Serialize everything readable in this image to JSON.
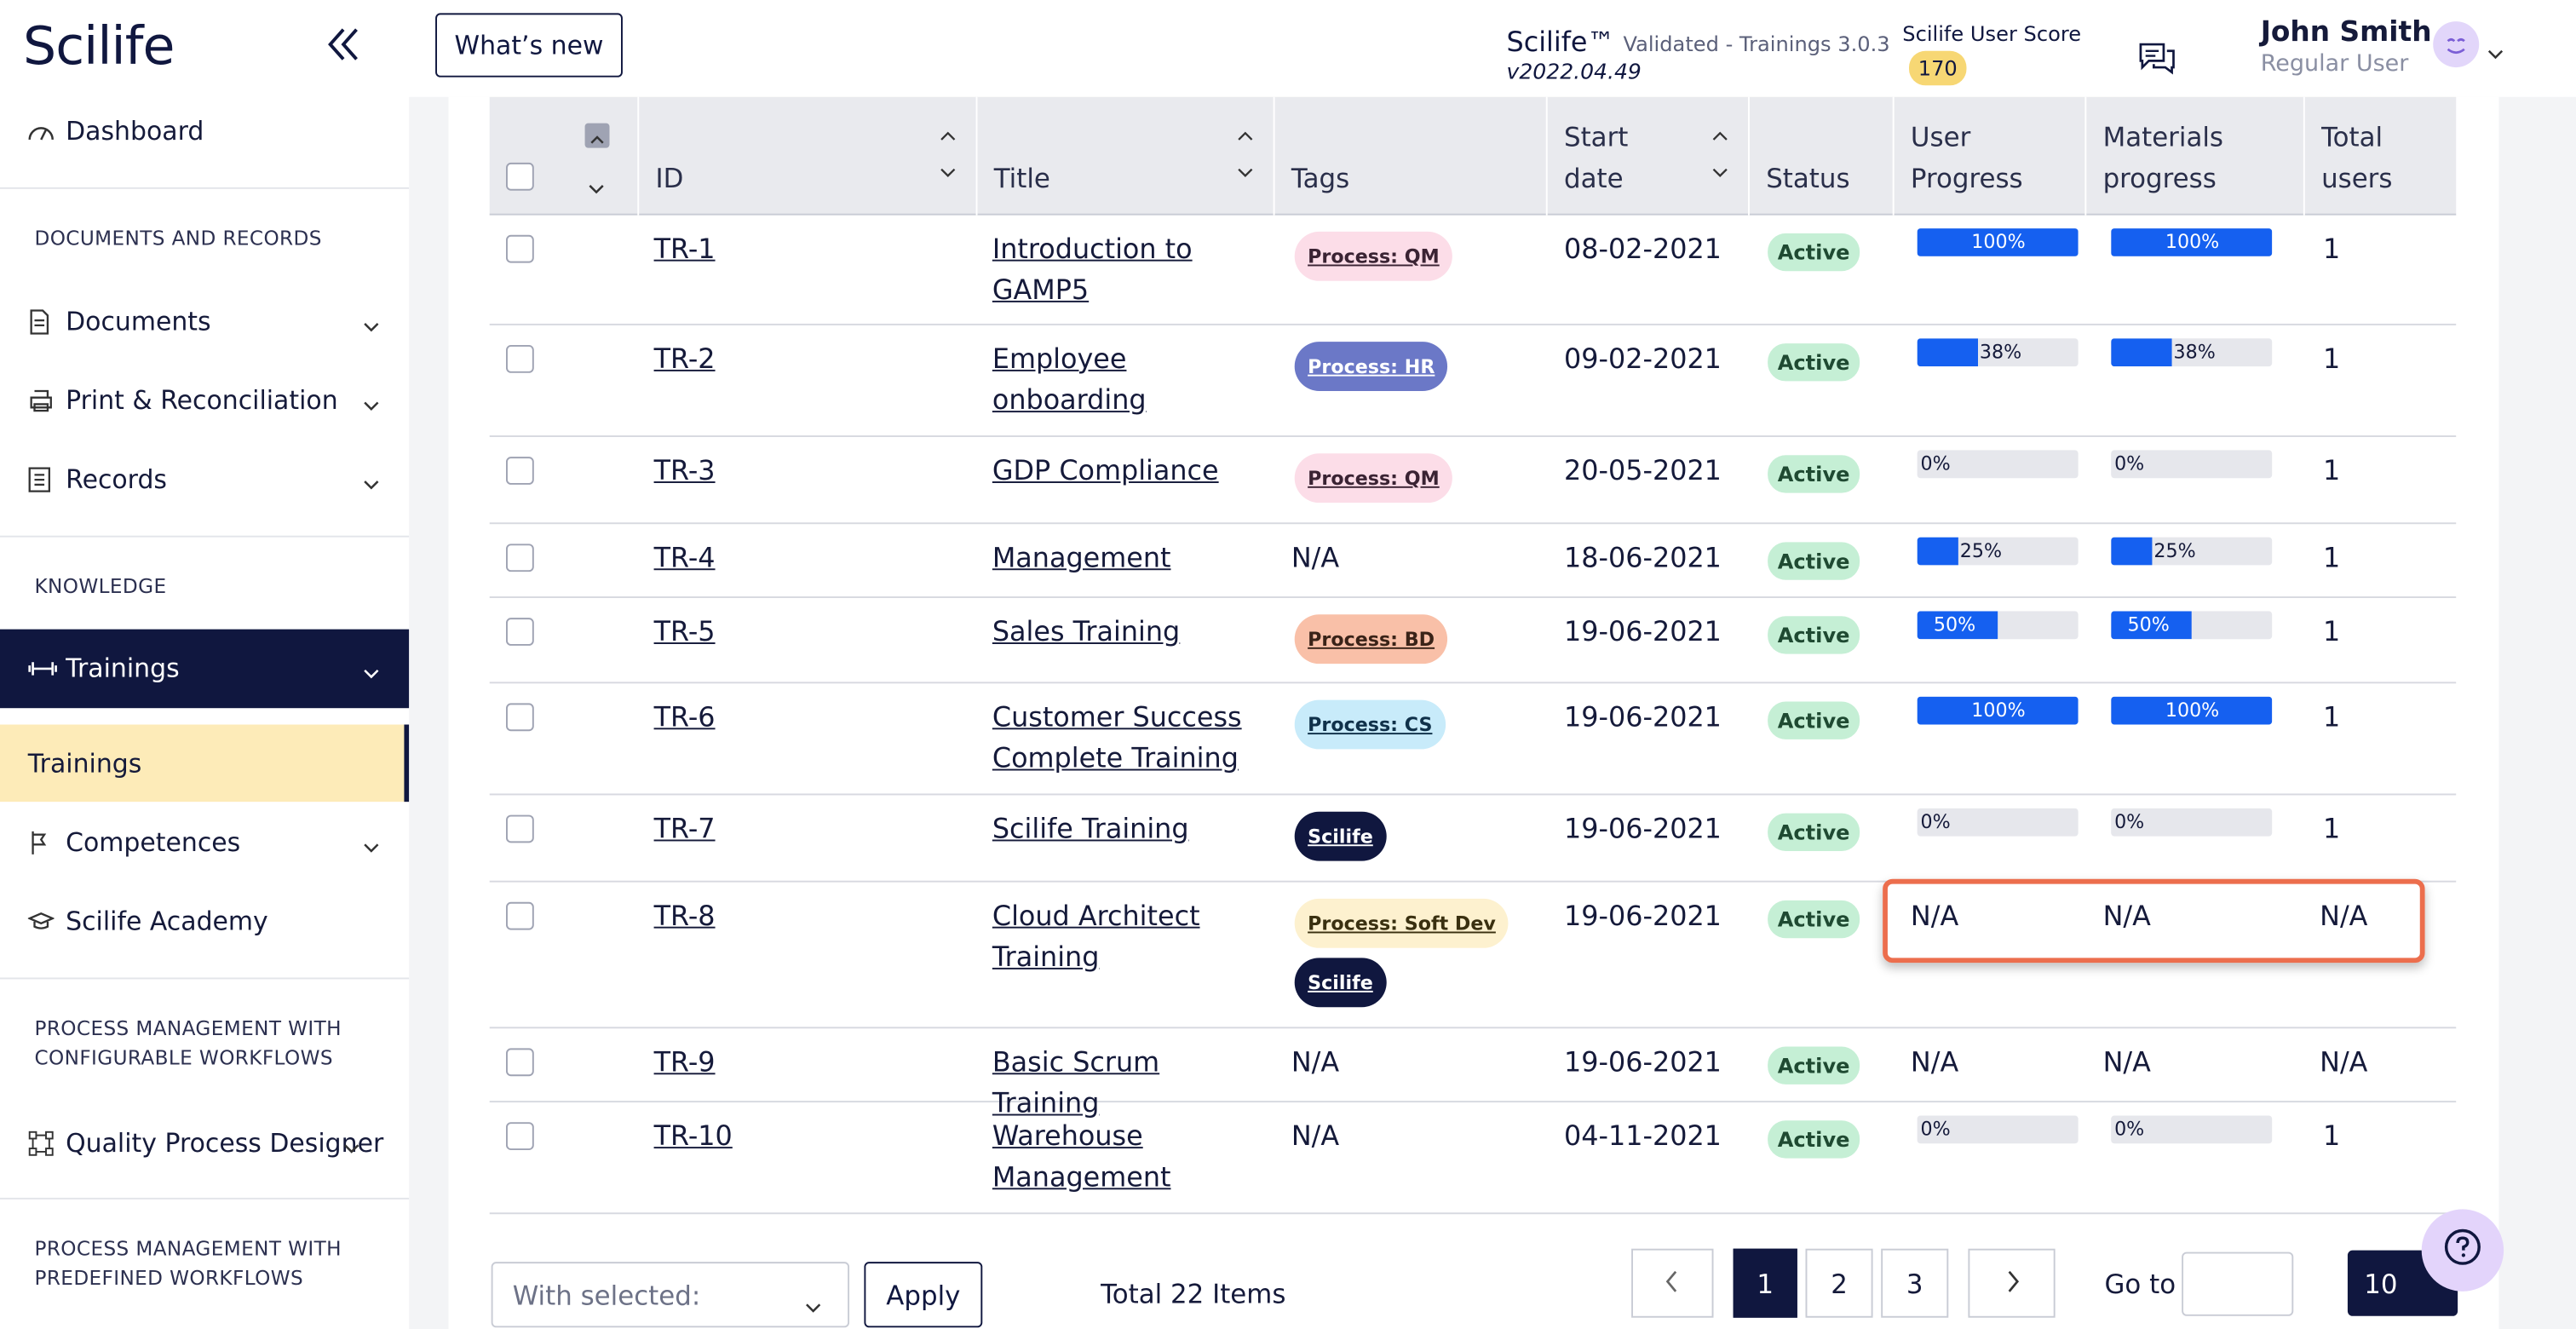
{
  "sidebar": {
    "logo": "Scilife",
    "dashboard": "Dashboard",
    "sec_docs": "DOCUMENTS AND RECORDS",
    "documents": "Documents",
    "print": "Print & Reconciliation",
    "records": "Records",
    "sec_knowledge": "KNOWLEDGE",
    "trainings": "Trainings",
    "trainings_sub": "Trainings",
    "competences": "Competences",
    "academy": "Scilife Academy",
    "sec_pm1_l1": "PROCESS MANAGEMENT WITH",
    "sec_pm1_l2": "CONFIGURABLE WORKFLOWS",
    "qpd": "Quality Process Designer",
    "sec_pm2_l1": "PROCESS MANAGEMENT WITH",
    "sec_pm2_l2": "PREDEFINED WORKFLOWS"
  },
  "topbar": {
    "whats_new": "What’s new",
    "brand": "Scilife™",
    "brand_sub": "Validated - Trainings 3.0.3",
    "version": "v2022.04.49",
    "score_label": "Scilife User Score",
    "score_value": "170",
    "user_name": "John Smith",
    "user_role": "Regular User"
  },
  "table": {
    "headers": {
      "id": "ID",
      "title": "Title",
      "tags": "Tags",
      "start_l1": "Start",
      "start_l2": "date",
      "status": "Status",
      "uprog_l1": "User",
      "uprog_l2": "Progress",
      "mprog_l1": "Materials",
      "mprog_l2": "progress",
      "total_l1": "Total",
      "total_l2": "users"
    },
    "rows": [
      {
        "id": "TR-1",
        "t1": "Introduction to",
        "t2": "GAMP5",
        "date": "08-02-2021",
        "status": "Active",
        "up": "100%",
        "mp": "100%",
        "tu": "1"
      },
      {
        "id": "TR-2",
        "t1": "Employee",
        "t2": "onboarding",
        "date": "09-02-2021",
        "status": "Active",
        "up": "38%",
        "mp": "38%",
        "tu": "1"
      },
      {
        "id": "TR-3",
        "t1": "GDP Compliance",
        "t2": "",
        "date": "20-05-2021",
        "status": "Active",
        "up": "0%",
        "mp": "0%",
        "tu": "1"
      },
      {
        "id": "TR-4",
        "t1": "Management",
        "t2": "",
        "tag_na": "N/A",
        "date": "18-06-2021",
        "status": "Active",
        "up": "25%",
        "mp": "25%",
        "tu": "1"
      },
      {
        "id": "TR-5",
        "t1": "Sales Training",
        "t2": "",
        "date": "19-06-2021",
        "status": "Active",
        "up": "50%",
        "mp": "50%",
        "tu": "1"
      },
      {
        "id": "TR-6",
        "t1": "Customer Success",
        "t2": "Complete Training",
        "date": "19-06-2021",
        "status": "Active",
        "up": "100%",
        "mp": "100%",
        "tu": "1"
      },
      {
        "id": "TR-7",
        "t1": "Scilife Training",
        "t2": "",
        "date": "19-06-2021",
        "status": "Active",
        "up": "0%",
        "mp": "0%",
        "tu": "1"
      },
      {
        "id": "TR-8",
        "t1": "Cloud Architect",
        "t2": "Training",
        "date": "19-06-2021",
        "status": "Active",
        "up": "N/A",
        "mp": "N/A",
        "tu": "N/A"
      },
      {
        "id": "TR-9",
        "t1": "Basic Scrum Training",
        "t2": "",
        "tag_na": "N/A",
        "date": "19-06-2021",
        "status": "Active",
        "up": "N/A",
        "mp": "N/A",
        "tu": "N/A"
      },
      {
        "id": "TR-10",
        "t1": "Warehouse",
        "t2": "Management",
        "tag_na": "N/A",
        "date": "04-11-2021",
        "status": "Active",
        "up": "0%",
        "mp": "0%",
        "tu": "1"
      }
    ],
    "tags": {
      "qm": "Process: QM",
      "hr": "Process: HR",
      "bd": "Process: BD",
      "cs": "Process: CS",
      "scilife": "Scilife",
      "softdev": "Process: Soft Dev"
    },
    "progress_fractions": [
      1.0,
      0.38,
      0.0,
      0.25,
      0.5,
      1.0,
      0.0,
      null,
      null,
      0.0
    ]
  },
  "footer": {
    "with_selected": "With selected:",
    "apply": "Apply",
    "total": "Total 22 Items",
    "pages": [
      "1",
      "2",
      "3"
    ],
    "goto": "Go to",
    "page_size": "10"
  },
  "colors": {
    "navy": "#10173f",
    "progress": "#1560f0",
    "active_badge": "#c5efd5",
    "highlight": "#ec6e4d",
    "subnav": "#fdebb8"
  }
}
